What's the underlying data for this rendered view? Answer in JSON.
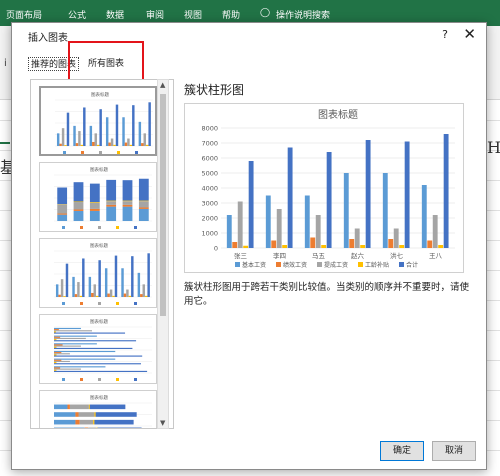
{
  "ribbon": {
    "tabs": [
      "页面布局",
      "公式",
      "数据",
      "审阅",
      "视图",
      "帮助",
      "操作说明搜索"
    ],
    "side_glyph": "i"
  },
  "sheet": {
    "left_text": "基本",
    "right_text": "H"
  },
  "dialog": {
    "title": "插入图表",
    "help": "?",
    "close": "✕",
    "tabs": {
      "recommended": "推荐的图表",
      "all": "所有图表"
    },
    "selected_type": "簇状柱形图",
    "description": "簇状柱形图用于跨若干类别比较值。当类别的顺序并不重要时，请使用它。",
    "buttons": {
      "ok": "确定",
      "cancel": "取消"
    }
  },
  "thumbnails": [
    {
      "title": "图表标题",
      "type": "clustered-column"
    },
    {
      "title": "图表标题",
      "type": "stacked-column"
    },
    {
      "title": "图表标题",
      "type": "clustered-column-alt"
    },
    {
      "title": "图表标题",
      "type": "clustered-bar"
    },
    {
      "title": "图表标题",
      "type": "stacked-bar"
    }
  ],
  "chart_data": {
    "type": "bar",
    "title": "图表标题",
    "categories": [
      "张三",
      "李四",
      "马五",
      "赵六",
      "洪七",
      "王八"
    ],
    "ylim": [
      0,
      8000
    ],
    "yticks": [
      0,
      1000,
      2000,
      3000,
      4000,
      5000,
      6000,
      7000,
      8000
    ],
    "grid": true,
    "legend_position": "bottom",
    "series": [
      {
        "name": "基本工资",
        "color": "#5b9bd5",
        "values": [
          2200,
          3500,
          3500,
          5000,
          5000,
          4200
        ]
      },
      {
        "name": "绩效工资",
        "color": "#ed7d31",
        "values": [
          400,
          500,
          700,
          600,
          600,
          500
        ]
      },
      {
        "name": "提成工资",
        "color": "#a5a5a5",
        "values": [
          3100,
          2600,
          2200,
          1300,
          1300,
          2200
        ]
      },
      {
        "name": "工龄补贴",
        "color": "#ffc000",
        "values": [
          150,
          200,
          200,
          200,
          200,
          200
        ]
      },
      {
        "name": "合计",
        "color": "#4472c4",
        "values": [
          5800,
          6700,
          6400,
          7200,
          7100,
          7600
        ]
      }
    ]
  }
}
